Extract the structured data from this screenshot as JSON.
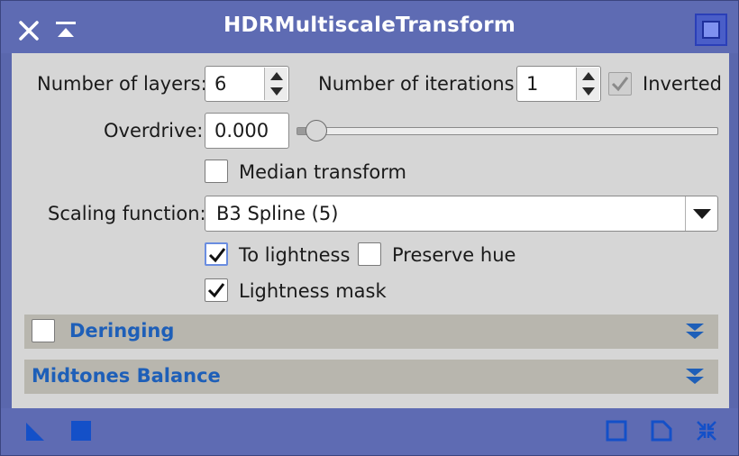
{
  "window": {
    "title": "HDRMultiscaleTransform",
    "accent_color": "#5e6bb3",
    "icons": [
      "close-icon",
      "shade-icon",
      "process-icon"
    ]
  },
  "layers": {
    "label": "Number of layers:",
    "value": "6"
  },
  "iterations": {
    "label": "Number of iterations:",
    "value": "1"
  },
  "inverted": {
    "label": "Inverted",
    "checked": true,
    "enabled": false
  },
  "overdrive": {
    "label": "Overdrive:",
    "value": "0.000",
    "slider_fraction": 0.0
  },
  "median_transform": {
    "label": "Median transform",
    "checked": false
  },
  "scaling_function": {
    "label": "Scaling function:",
    "selected": "B3 Spline (5)"
  },
  "to_lightness": {
    "label": "To lightness",
    "checked": true
  },
  "preserve_hue": {
    "label": "Preserve hue",
    "checked": false
  },
  "lightness_mask": {
    "label": "Lightness mask",
    "checked": true
  },
  "sections": {
    "deringing": {
      "title": "Deringing",
      "enabled": false
    },
    "midtones": {
      "title": "Midtones Balance"
    }
  },
  "bottom_icons": [
    "new-instance-icon",
    "apply-global-icon",
    "reset-icon",
    "documentation-icon",
    "preferences-icon"
  ],
  "section_title_color": "#1e5fb8"
}
